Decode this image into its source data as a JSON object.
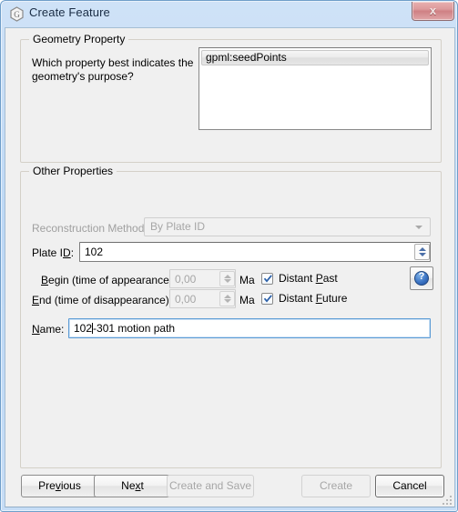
{
  "window": {
    "title": "Create Feature",
    "icon": "gplates-logo-icon",
    "close_label": "x",
    "titlebar_color": "#bdd8f5",
    "client_color": "#f0f0f0"
  },
  "geometry_property": {
    "group_title": "Geometry Property",
    "question": "Which property best indicates the geometry's purpose?",
    "list": {
      "items": [
        {
          "label": "gpml:seedPoints",
          "selected": true
        }
      ]
    }
  },
  "other_properties": {
    "group_title": "Other Properties",
    "reconstruction_method": {
      "label": "Reconstruction Method:",
      "value": "By Plate ID",
      "disabled": true
    },
    "plate_id": {
      "label_pre": "Plate I",
      "label_mnemonic": "D",
      "label_post": ":",
      "value": "102",
      "disabled": false
    },
    "begin_time": {
      "label_mnemonic": "B",
      "label_post": "egin (time of appearance):",
      "value": "0,00",
      "unit": "Ma",
      "disabled": true,
      "checkbox": {
        "label_pre": "Distant ",
        "label_mnemonic": "P",
        "label_post": "ast",
        "checked": true
      }
    },
    "end_time": {
      "label_mnemonic": "E",
      "label_post": "nd (time of disappearance):",
      "value": "0,00",
      "unit": "Ma",
      "disabled": true,
      "checkbox": {
        "label_pre": "Distant ",
        "label_mnemonic": "F",
        "label_post": "uture",
        "checked": true
      }
    },
    "help": {
      "glyph": "?"
    },
    "name": {
      "label_mnemonic": "N",
      "label_post": "ame:",
      "value_before_caret": "102",
      "value_after_caret": "-301 motion path"
    }
  },
  "buttons": {
    "previous": {
      "label_pre": "Pre",
      "label_mnemonic": "v",
      "label_post": "ious",
      "disabled": false
    },
    "next": {
      "label_pre": "Ne",
      "label_mnemonic": "x",
      "label_post": "t",
      "disabled": false
    },
    "create_and_save": {
      "label": "Create and Save",
      "disabled": true
    },
    "create": {
      "label": "Create",
      "disabled": true
    },
    "cancel": {
      "label": "Cancel",
      "disabled": false
    }
  }
}
